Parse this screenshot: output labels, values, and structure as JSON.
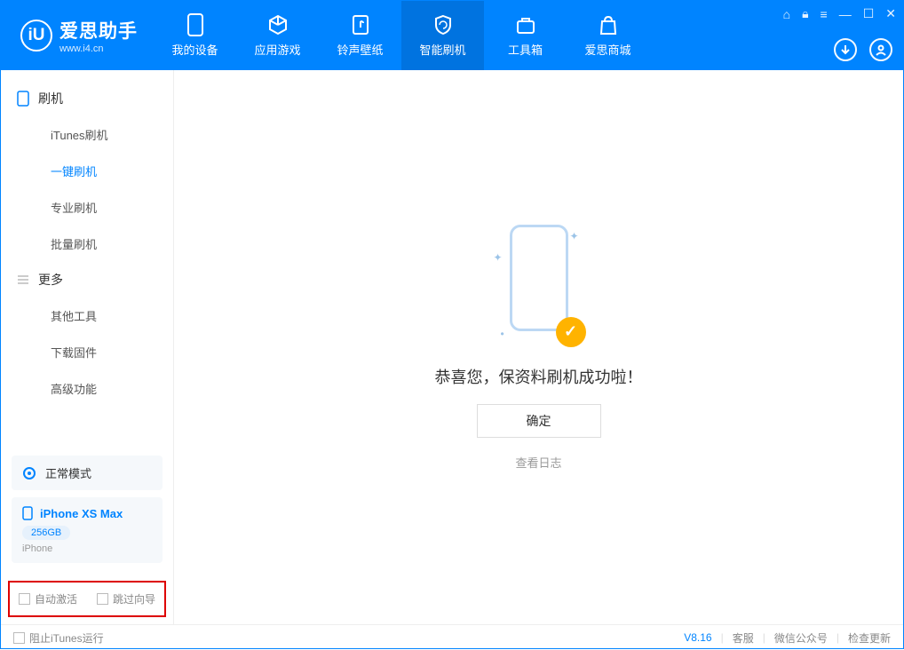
{
  "app": {
    "name": "爱思助手",
    "url": "www.i4.cn"
  },
  "tabs": [
    {
      "label": "我的设备"
    },
    {
      "label": "应用游戏"
    },
    {
      "label": "铃声壁纸"
    },
    {
      "label": "智能刷机"
    },
    {
      "label": "工具箱"
    },
    {
      "label": "爱思商城"
    }
  ],
  "sidebar": {
    "group1_title": "刷机",
    "group1_items": [
      "iTunes刷机",
      "一键刷机",
      "专业刷机",
      "批量刷机"
    ],
    "group2_title": "更多",
    "group2_items": [
      "其他工具",
      "下载固件",
      "高级功能"
    ],
    "status_label": "正常模式",
    "device_name": "iPhone XS Max",
    "device_capacity": "256GB",
    "device_type": "iPhone",
    "checkbox1": "自动激活",
    "checkbox2": "跳过向导"
  },
  "main": {
    "success_msg": "恭喜您，保资料刷机成功啦！",
    "ok_button": "确定",
    "log_link": "查看日志"
  },
  "statusbar": {
    "block_itunes": "阻止iTunes运行",
    "version": "V8.16",
    "links": [
      "客服",
      "微信公众号",
      "检查更新"
    ]
  }
}
